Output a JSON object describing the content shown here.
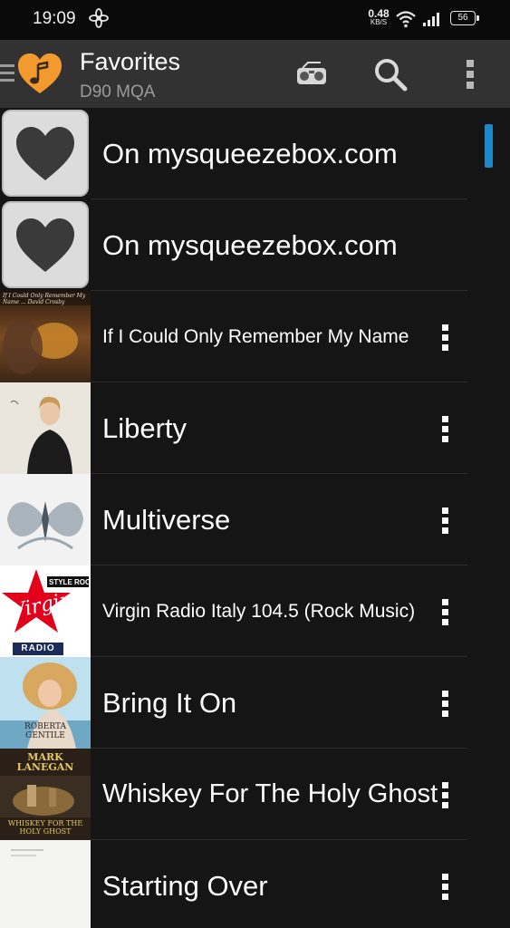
{
  "status_bar": {
    "time": "19:09",
    "net_speed": "0.48",
    "net_unit": "KB/S",
    "battery": "56"
  },
  "toolbar": {
    "title": "Favorites",
    "subtitle": "D90 MQA"
  },
  "colors": {
    "accent": "#1e88c8",
    "logo_orange": "#f29a2e",
    "toolbar_bg": "#323232",
    "list_bg": "#151515"
  },
  "favorites": [
    {
      "title": "On mysqueezebox.com",
      "thumb": "heart-icon"
    },
    {
      "title": "On mysqueezebox.com",
      "thumb": "heart-icon"
    },
    {
      "title": "If I Could Only Remember My Name",
      "thumb": "album-art",
      "art_text": "If I Could Only Remember My Name ... David Crosby"
    },
    {
      "title": "Liberty",
      "thumb": "album-art"
    },
    {
      "title": "Multiverse",
      "thumb": "album-art"
    },
    {
      "title": "Virgin Radio Italy 104.5 (Rock Music)",
      "thumb": "station-logo",
      "logo_brand": "Virgin",
      "logo_tag": "STYLE ROCK",
      "logo_footer": "RADIO"
    },
    {
      "title": "Bring It On",
      "thumb": "album-art",
      "art_text": "ROBERTA GENTILE"
    },
    {
      "title": "Whiskey For The Holy Ghost",
      "thumb": "album-art",
      "art_top": "MARK LANEGAN",
      "art_bottom": "WHISKEY FOR THE HOLY GHOST"
    },
    {
      "title": "Starting Over",
      "thumb": "album-art"
    }
  ]
}
